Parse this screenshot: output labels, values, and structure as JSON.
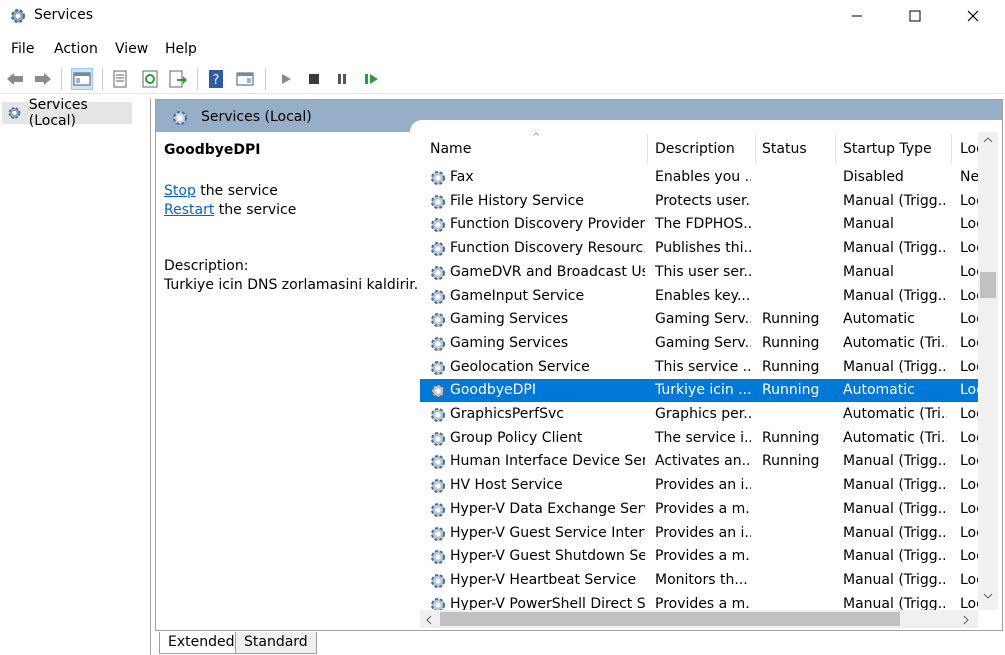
{
  "window": {
    "title": "Services"
  },
  "menu": [
    "File",
    "Action",
    "View",
    "Help"
  ],
  "tree": {
    "root": "Services (Local)"
  },
  "header": {
    "title": "Services (Local)"
  },
  "details": {
    "service_name": "GoodbyeDPI",
    "stop_link": "Stop",
    "stop_suffix": " the service",
    "restart_link": "Restart",
    "restart_suffix": " the service",
    "description_label": "Description:",
    "description_text": "Turkiye icin DNS zorlamasini kaldirir."
  },
  "grid": {
    "columns": [
      "Name",
      "Description",
      "Status",
      "Startup Type",
      "Log"
    ],
    "rows": [
      {
        "name": "Fax",
        "desc": "Enables you ...",
        "status": "",
        "startup": "Disabled",
        "logon": "Ne"
      },
      {
        "name": "File History Service",
        "desc": "Protects user...",
        "status": "",
        "startup": "Manual (Trigg...",
        "logon": "Loc"
      },
      {
        "name": "Function Discovery Provider ...",
        "desc": "The FDPHOS...",
        "status": "",
        "startup": "Manual",
        "logon": "Loc"
      },
      {
        "name": "Function Discovery Resourc...",
        "desc": "Publishes thi...",
        "status": "",
        "startup": "Manual (Trigg...",
        "logon": "Loc"
      },
      {
        "name": "GameDVR and Broadcast Us...",
        "desc": "This user ser...",
        "status": "",
        "startup": "Manual",
        "logon": "Loc"
      },
      {
        "name": "GameInput Service",
        "desc": "Enables key...",
        "status": "",
        "startup": "Manual (Trigg...",
        "logon": "Loc"
      },
      {
        "name": "Gaming Services",
        "desc": "Gaming Serv...",
        "status": "Running",
        "startup": "Automatic",
        "logon": "Loc"
      },
      {
        "name": "Gaming Services",
        "desc": "Gaming Serv...",
        "status": "Running",
        "startup": "Automatic (Tri...",
        "logon": "Loc"
      },
      {
        "name": "Geolocation Service",
        "desc": "This service ...",
        "status": "Running",
        "startup": "Manual (Trigg...",
        "logon": "Loc"
      },
      {
        "name": "GoodbyeDPI",
        "desc": "Turkiye icin ...",
        "status": "Running",
        "startup": "Automatic",
        "logon": "Loc"
      },
      {
        "name": "GraphicsPerfSvc",
        "desc": "Graphics per...",
        "status": "",
        "startup": "Automatic (Tri...",
        "logon": "Loc"
      },
      {
        "name": "Group Policy Client",
        "desc": "The service i...",
        "status": "Running",
        "startup": "Automatic (Tri...",
        "logon": "Loc"
      },
      {
        "name": "Human Interface Device Serv...",
        "desc": "Activates an...",
        "status": "Running",
        "startup": "Manual (Trigg...",
        "logon": "Loc"
      },
      {
        "name": "HV Host Service",
        "desc": "Provides an i...",
        "status": "",
        "startup": "Manual (Trigg...",
        "logon": "Loc"
      },
      {
        "name": "Hyper-V Data Exchange Serv...",
        "desc": "Provides a m...",
        "status": "",
        "startup": "Manual (Trigg...",
        "logon": "Loc"
      },
      {
        "name": "Hyper-V Guest Service Interf...",
        "desc": "Provides an i...",
        "status": "",
        "startup": "Manual (Trigg...",
        "logon": "Loc"
      },
      {
        "name": "Hyper-V Guest Shutdown Se...",
        "desc": "Provides a m...",
        "status": "",
        "startup": "Manual (Trigg...",
        "logon": "Loc"
      },
      {
        "name": "Hyper-V Heartbeat Service",
        "desc": "Monitors th...",
        "status": "",
        "startup": "Manual (Trigg...",
        "logon": "Loc"
      },
      {
        "name": "Hyper-V PowerShell Direct S...",
        "desc": "Provides a m...",
        "status": "",
        "startup": "Manual (Trigg...",
        "logon": "Loc"
      }
    ],
    "selected_index": 9
  },
  "tabs": [
    "Extended",
    "Standard"
  ],
  "colors": {
    "selection": "#0078d7",
    "header_band": "#96aec8",
    "link": "#0066cc"
  }
}
